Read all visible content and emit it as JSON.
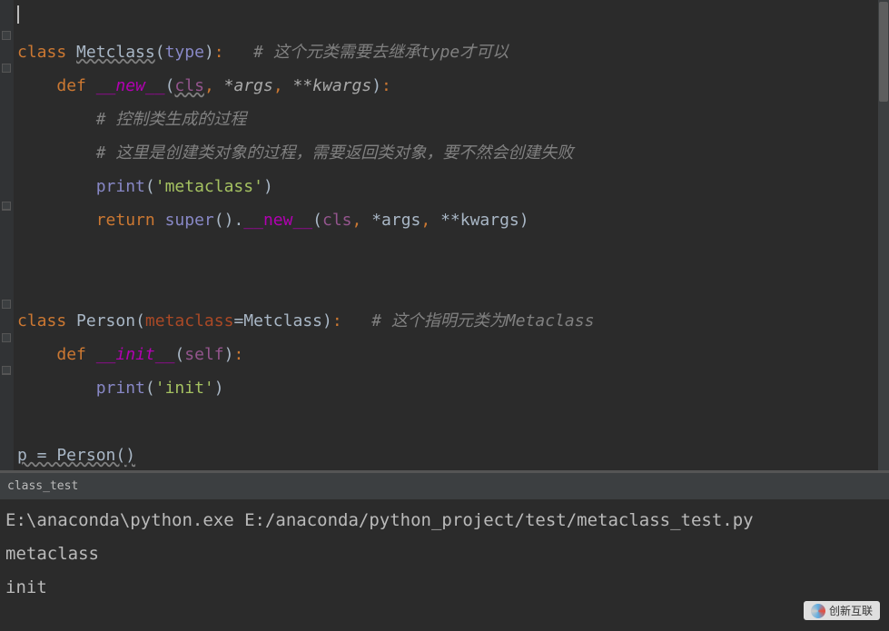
{
  "editor": {
    "lines": [
      {
        "segments": []
      },
      {
        "segments": [
          {
            "text": "class ",
            "cls": "kw-orange"
          },
          {
            "text": "Metclass",
            "cls": "classname classname-uw"
          },
          {
            "text": "(",
            "cls": "paren"
          },
          {
            "text": "type",
            "cls": "builtin"
          },
          {
            "text": ")",
            "cls": "paren"
          },
          {
            "text": ":",
            "cls": "punct"
          },
          {
            "text": "   ",
            "cls": ""
          },
          {
            "text": "# 这个元类需要去继承type才可以",
            "cls": "comment"
          }
        ]
      },
      {
        "segments": [
          {
            "text": "    ",
            "cls": ""
          },
          {
            "text": "def ",
            "cls": "kw-orange"
          },
          {
            "text": "__new__",
            "cls": "funcname"
          },
          {
            "text": "(",
            "cls": "paren"
          },
          {
            "text": "cls",
            "cls": "param-cls"
          },
          {
            "text": ", ",
            "cls": "punct"
          },
          {
            "text": "*args",
            "cls": "param"
          },
          {
            "text": ", ",
            "cls": "punct"
          },
          {
            "text": "**kwargs",
            "cls": "param"
          },
          {
            "text": ")",
            "cls": "paren"
          },
          {
            "text": ":",
            "cls": "punct"
          }
        ]
      },
      {
        "segments": [
          {
            "text": "        ",
            "cls": ""
          },
          {
            "text": "# 控制类生成的过程",
            "cls": "comment"
          }
        ]
      },
      {
        "segments": [
          {
            "text": "        ",
            "cls": ""
          },
          {
            "text": "# 这里是创建类对象的过程，需要返回类对象，要不然会创建失败",
            "cls": "comment"
          }
        ]
      },
      {
        "segments": [
          {
            "text": "        ",
            "cls": ""
          },
          {
            "text": "print",
            "cls": "builtin"
          },
          {
            "text": "(",
            "cls": "paren"
          },
          {
            "text": "'metaclass'",
            "cls": "string"
          },
          {
            "text": ")",
            "cls": "paren"
          }
        ]
      },
      {
        "segments": [
          {
            "text": "        ",
            "cls": ""
          },
          {
            "text": "return ",
            "cls": "kw-orange"
          },
          {
            "text": "super",
            "cls": "builtin"
          },
          {
            "text": "()",
            "cls": "paren"
          },
          {
            "text": ".",
            "cls": "paren"
          },
          {
            "text": "__new__",
            "cls": "funcref"
          },
          {
            "text": "(",
            "cls": "paren"
          },
          {
            "text": "cls",
            "cls": "param-self"
          },
          {
            "text": ", ",
            "cls": "punct"
          },
          {
            "text": "*args",
            "cls": "paren"
          },
          {
            "text": ", ",
            "cls": "punct"
          },
          {
            "text": "**kwargs",
            "cls": "paren"
          },
          {
            "text": ")",
            "cls": "paren"
          }
        ]
      },
      {
        "segments": []
      },
      {
        "segments": []
      },
      {
        "segments": [
          {
            "text": "class ",
            "cls": "kw-orange"
          },
          {
            "text": "Person",
            "cls": "classname"
          },
          {
            "text": "(",
            "cls": "paren"
          },
          {
            "text": "metaclass",
            "cls": "metakey"
          },
          {
            "text": "=",
            "cls": "paren"
          },
          {
            "text": "Metclass",
            "cls": "classname"
          },
          {
            "text": ")",
            "cls": "paren"
          },
          {
            "text": ":",
            "cls": "punct"
          },
          {
            "text": "   ",
            "cls": ""
          },
          {
            "text": "# 这个指明元类为Metaclass",
            "cls": "comment"
          }
        ]
      },
      {
        "segments": [
          {
            "text": "    ",
            "cls": ""
          },
          {
            "text": "def ",
            "cls": "kw-orange"
          },
          {
            "text": "__init__",
            "cls": "funcname"
          },
          {
            "text": "(",
            "cls": "paren"
          },
          {
            "text": "self",
            "cls": "param-self"
          },
          {
            "text": ")",
            "cls": "paren"
          },
          {
            "text": ":",
            "cls": "punct"
          }
        ]
      },
      {
        "segments": [
          {
            "text": "        ",
            "cls": ""
          },
          {
            "text": "print",
            "cls": "builtin"
          },
          {
            "text": "(",
            "cls": "paren"
          },
          {
            "text": "'init'",
            "cls": "string"
          },
          {
            "text": ")",
            "cls": "paren"
          }
        ]
      },
      {
        "segments": []
      },
      {
        "segments": [
          {
            "text": "p = Person()",
            "cls": "wavy-under"
          }
        ]
      }
    ]
  },
  "tab": {
    "name": "class_test"
  },
  "console": {
    "lines": [
      "E:\\anaconda\\python.exe E:/anaconda/python_project/test/metaclass_test.py",
      "metaclass",
      "init"
    ]
  },
  "watermark": {
    "text": "创新互联"
  }
}
